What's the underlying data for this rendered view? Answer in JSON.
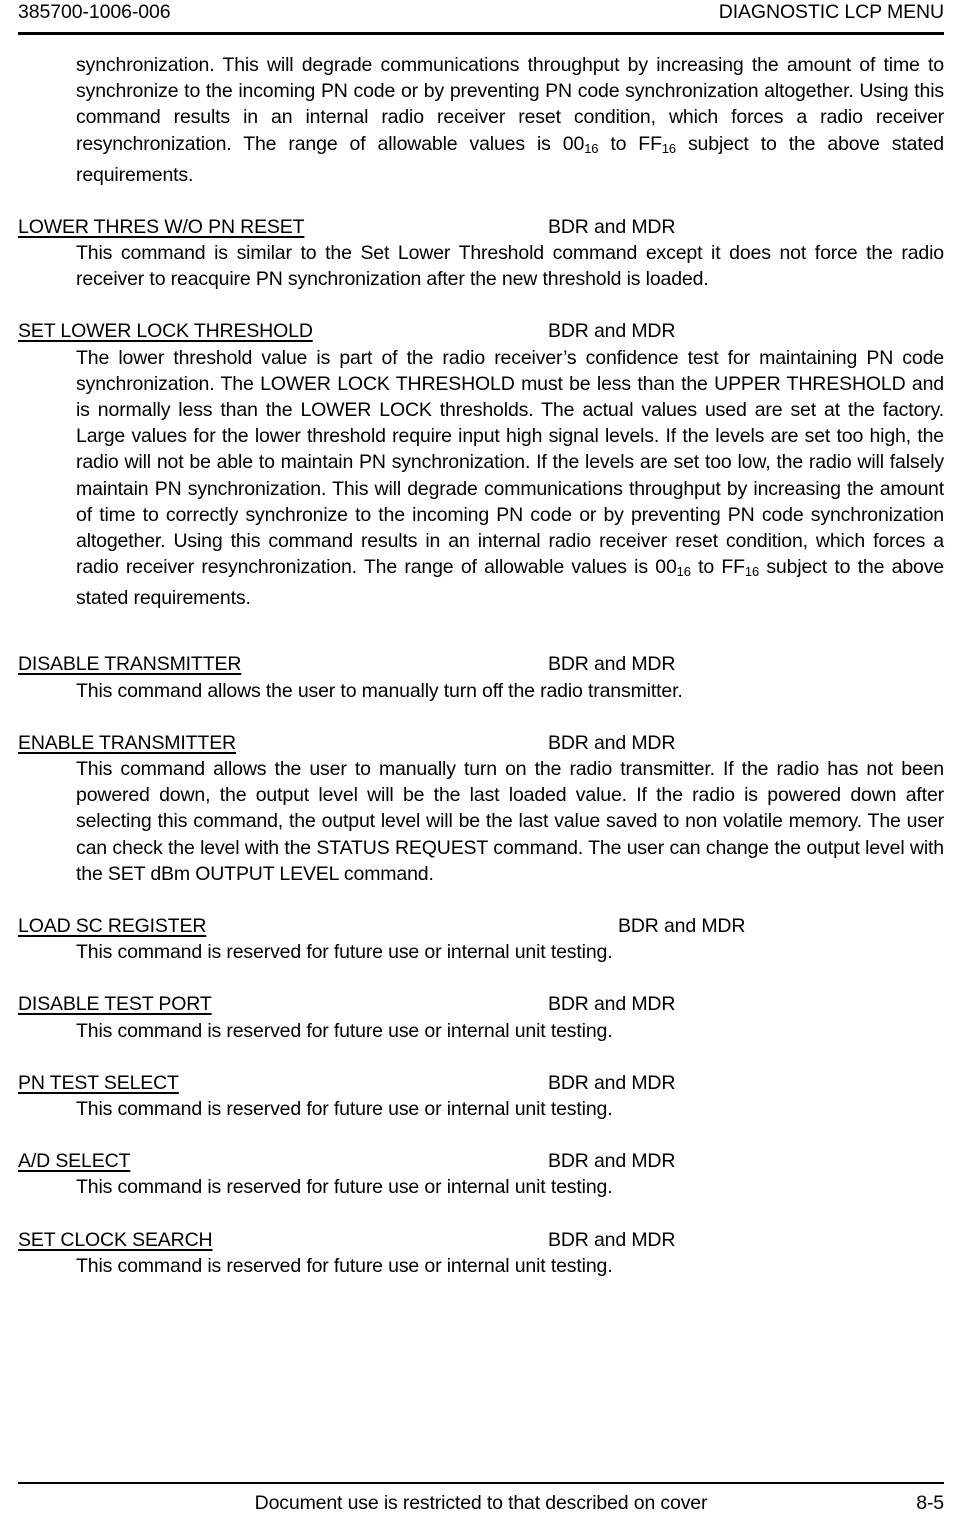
{
  "header": {
    "doc_number": "385700-1006-006",
    "title": "DIAGNOSTIC LCP MENU"
  },
  "intro_paragraph": {
    "part1": "synchronization.  This will degrade communications throughput by increasing the amount of time to synchronize to the incoming PN code or by preventing PN code synchronization altogether.  Using this command results in an internal radio receiver reset condition, which forces a radio receiver resynchronization. The range of allowable values is 00",
    "sub1": "16",
    "part2": " to FF",
    "sub2": "16",
    "part3": " subject to the above stated requirements."
  },
  "sections": [
    {
      "title": "LOWER THRES W/O PN RESET",
      "applies_to": "BDR and MDR",
      "applies_column": "col-a",
      "description": "This command is similar to the Set Lower Threshold command except it does not force the radio receiver to reacquire PN synchronization after the new threshold is loaded."
    },
    {
      "title": "SET LOWER LOCK THRESHOLD",
      "applies_to": "BDR and MDR",
      "applies_column": "col-a",
      "description_part1": "The lower threshold value is part of the radio receiver’s confidence test for maintaining PN code synchronization.  The LOWER LOCK THRESHOLD must be less than the UPPER THRESHOLD and is normally less than the LOWER LOCK thresholds.  The actual values used are set at the factory.   Large values for the lower threshold require input high signal levels. If the levels are set too high, the radio will not be able to maintain PN synchronization. If the levels are set too low, the radio will falsely maintain PN synchronization.  This will degrade communications throughput by increasing the amount of time to correctly synchronize to the incoming PN code or by preventing PN code synchronization altogether.  Using this command results in an internal radio receiver reset condition, which forces a radio receiver resynchronization. The range of allowable values is 00",
      "sub1": "16",
      "description_part2": " to FF",
      "sub2": "16",
      "description_part3": " subject to the above stated requirements."
    },
    {
      "title": "DISABLE TRANSMITTER",
      "applies_to": "BDR and MDR",
      "applies_column": "col-a",
      "description": "This command allows the user to manually turn off the radio transmitter."
    },
    {
      "title": "ENABLE TRANSMITTER",
      "applies_to": "BDR and MDR",
      "applies_column": "col-a",
      "description": "This command allows the user to manually turn on the radio transmitter.  If the radio has not been powered down, the output level will be the last loaded value.  If the radio is powered down after selecting this command, the output level will be the last value saved to non volatile memory.  The user can check the level with the STATUS REQUEST command.  The user can change the output level with the SET dBm OUTPUT LEVEL command."
    },
    {
      "title": "LOAD SC REGISTER",
      "applies_to": "BDR and MDR",
      "applies_column": "col-b",
      "description": "This command is reserved for future use or internal unit testing."
    },
    {
      "title": "DISABLE TEST PORT",
      "applies_to": "BDR and MDR",
      "applies_column": "col-a",
      "description": "This command is reserved for future use or internal unit testing."
    },
    {
      "title": "PN TEST SELECT",
      "applies_to": "BDR and MDR",
      "applies_column": "col-a",
      "description": "This command is reserved for future use or internal unit testing."
    },
    {
      "title": "A/D SELECT",
      "applies_to": "BDR and MDR",
      "applies_column": "col-a",
      "description": "This command is reserved for future use or internal unit testing."
    },
    {
      "title": "SET CLOCK SEARCH",
      "applies_to": "BDR and MDR",
      "applies_column": "col-a",
      "description": "This command is reserved for future use or internal unit testing."
    }
  ],
  "footer": {
    "notice": "Document use is restricted to that described on cover",
    "page_number": "8-5"
  }
}
